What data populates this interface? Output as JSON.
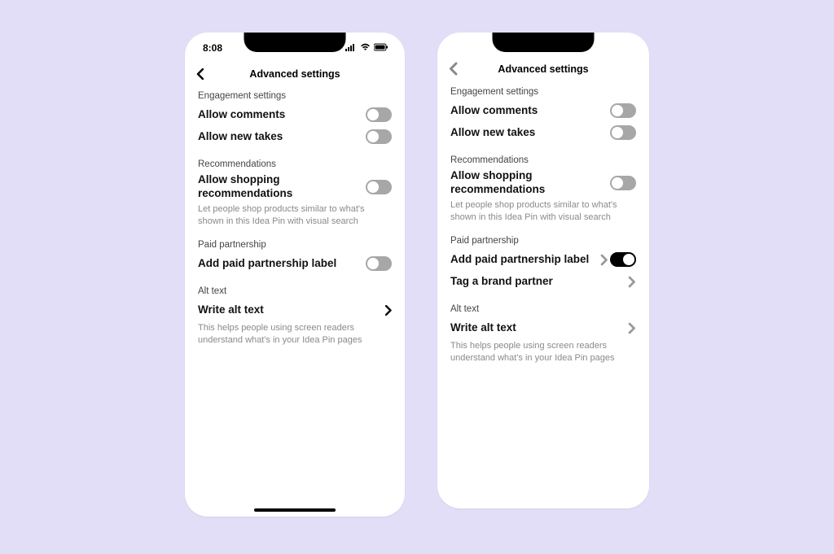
{
  "left": {
    "statusbar": {
      "time": "8:08"
    },
    "header": {
      "title": "Advanced settings"
    },
    "sections": {
      "engagement": {
        "label": "Engagement settings",
        "allow_comments": "Allow comments",
        "allow_new_takes": "Allow new takes"
      },
      "recommendations": {
        "label": "Recommendations",
        "allow_shopping": "Allow shopping recommendations",
        "helper": "Let people shop products similar to what's shown in this Idea Pin with visual search"
      },
      "paid": {
        "label": "Paid partnership",
        "add_label": "Add paid partnership label"
      },
      "alt": {
        "label": "Alt text",
        "write": "Write alt text",
        "helper": "This helps people using screen readers understand what's in your Idea Pin pages"
      }
    }
  },
  "right": {
    "header": {
      "title": "Advanced settings"
    },
    "sections": {
      "engagement": {
        "label": "Engagement settings",
        "allow_comments": "Allow comments",
        "allow_new_takes": "Allow new takes"
      },
      "recommendations": {
        "label": "Recommendations",
        "allow_shopping": "Allow shopping recommendations",
        "helper": "Let people shop products similar to what's shown in this Idea Pin with visual search"
      },
      "paid": {
        "label": "Paid partnership",
        "add_label": "Add paid partnership label",
        "tag_partner": "Tag a brand partner"
      },
      "alt": {
        "label": "Alt text",
        "write": "Write alt text",
        "helper": "This helps people using screen readers understand what's in your Idea Pin pages"
      }
    }
  }
}
